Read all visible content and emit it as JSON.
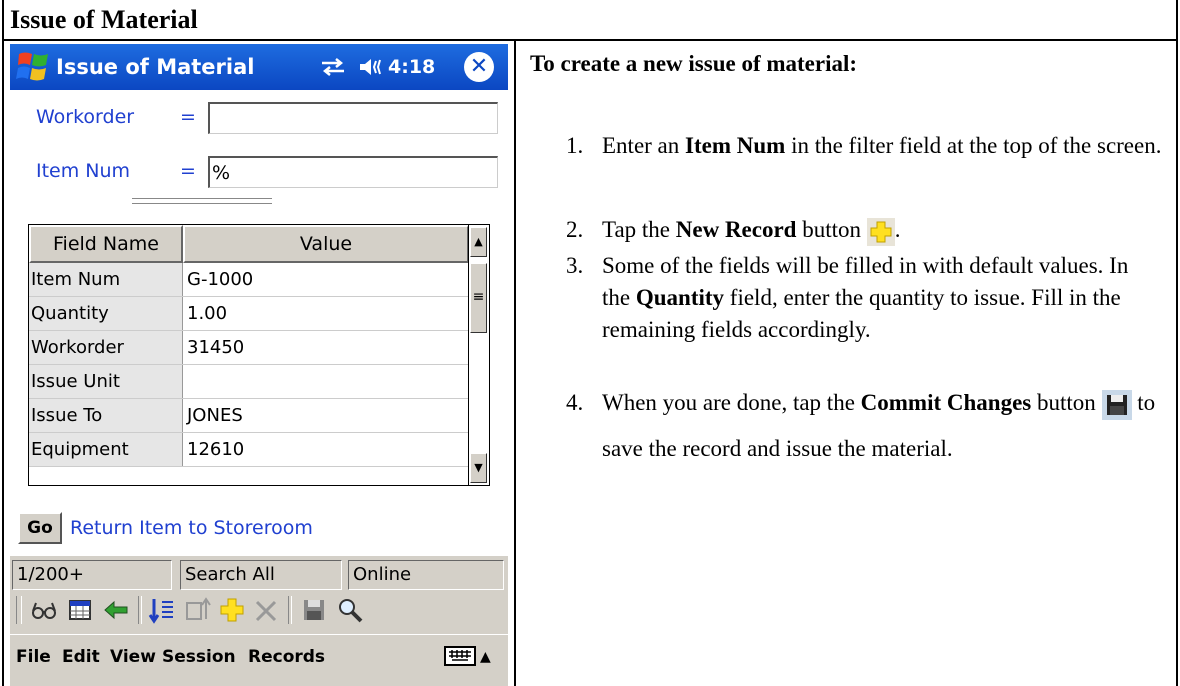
{
  "doc_title": "Issue of Material",
  "device": {
    "app_title": "Issue of Material",
    "clock": "4:18",
    "fields": [
      {
        "label": "Workorder",
        "eq": "=",
        "value": ""
      },
      {
        "label": "Item Num",
        "eq": "=",
        "value": "%"
      }
    ],
    "grid": {
      "headers": [
        "Field Name",
        "Value"
      ],
      "rows": [
        {
          "name": "Item Num",
          "value": "G-1000"
        },
        {
          "name": "Quantity",
          "value": "1.00"
        },
        {
          "name": "Workorder",
          "value": "31450"
        },
        {
          "name": "Issue Unit",
          "value": ""
        },
        {
          "name": "Issue To",
          "value": "JONES"
        },
        {
          "name": "Equipment",
          "value": "12610"
        }
      ]
    },
    "go_label": "Go",
    "go_link": "Return Item to Storeroom",
    "status": {
      "count": "1/200+",
      "search": "Search All",
      "mode": "Online"
    },
    "menu": [
      "File",
      "Edit",
      "View",
      "Session",
      "Records"
    ]
  },
  "instructions": {
    "heading": "To create a new issue of material:",
    "steps": [
      {
        "n": "1.",
        "a": "Enter an ",
        "b": "Item Num",
        "c": " in the filter field at the top of the screen."
      },
      {
        "n": "2.",
        "a": "Tap the ",
        "b": "New Record",
        "c": " button",
        "d": "."
      },
      {
        "n": "3.",
        "a": "Some of the fields will be filled in with default values.  In the ",
        "b": "Quantity",
        "c": " field, enter the quantity to issue.  Fill in the remaining fields accordingly."
      },
      {
        "n": "4.",
        "a": "When you are done, tap the ",
        "b": "Commit Changes",
        "c": " button",
        "d": " to save the record and issue the material."
      }
    ]
  }
}
